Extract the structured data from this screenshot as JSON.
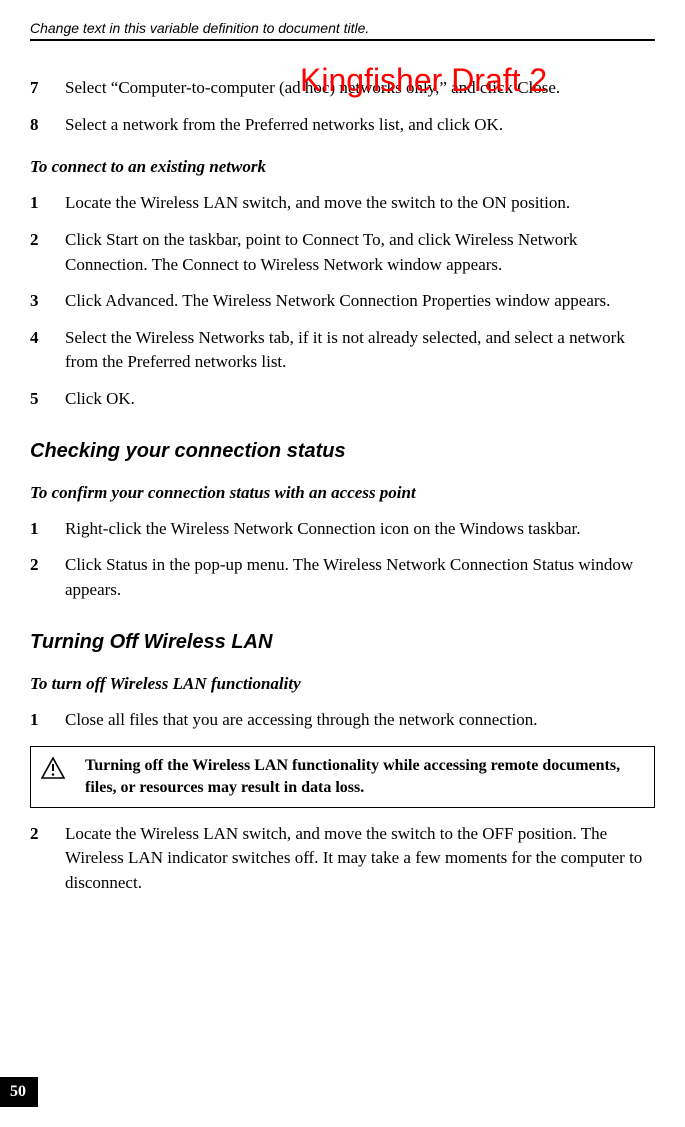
{
  "header": "Change text in this variable definition to document title.",
  "watermark": "Kingfisher Draft 2",
  "intro_steps": [
    {
      "num": "7",
      "text": "Select “Computer-to-computer (ad hoc) networks only,” and click Close."
    },
    {
      "num": "8",
      "text": "Select a network from the Preferred networks list, and click OK."
    }
  ],
  "section1": {
    "title": "To connect to an existing network",
    "steps": [
      {
        "num": "1",
        "text": "Locate the Wireless LAN switch, and move the switch to the ON position."
      },
      {
        "num": "2",
        "text": "Click Start on the taskbar, point to Connect To, and click Wireless Network Connection. The Connect to Wireless Network window appears."
      },
      {
        "num": "3",
        "text": "Click Advanced. The Wireless Network Connection Properties window appears."
      },
      {
        "num": "4",
        "text": "Select the Wireless Networks tab, if it is not already selected, and select a network from the Preferred networks list."
      },
      {
        "num": "5",
        "text": "Click OK."
      }
    ]
  },
  "section2": {
    "heading": "Checking your connection status",
    "subheading": "To confirm your connection status with an access point",
    "steps": [
      {
        "num": "1",
        "text": "Right-click the Wireless Network Connection icon on the Windows taskbar."
      },
      {
        "num": "2",
        "text": "Click Status in the pop-up menu. The Wireless Network Connection Status window appears."
      }
    ]
  },
  "section3": {
    "heading": "Turning Off Wireless LAN",
    "subheading": "To turn off Wireless LAN functionality",
    "step1": {
      "num": "1",
      "text": "Close all files that you are accessing through the network connection."
    },
    "warning": "Turning off the Wireless LAN functionality while accessing remote documents, files, or resources may result in data loss.",
    "step2": {
      "num": "2",
      "text": "Locate the Wireless LAN switch, and move the switch to the OFF position. The Wireless LAN indicator switches off. It may take a few moments for the computer to disconnect."
    }
  },
  "page_number": "50"
}
